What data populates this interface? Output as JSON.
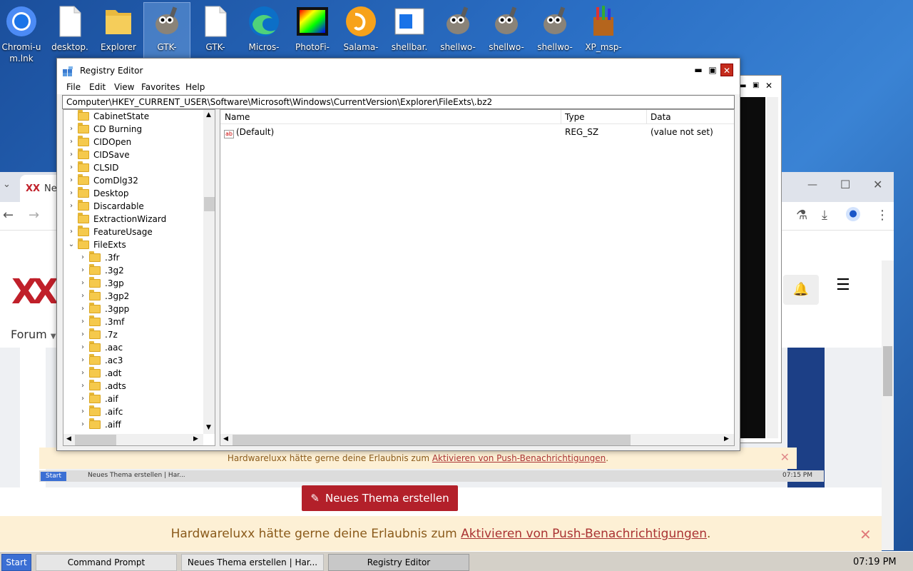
{
  "desktop": {
    "icons": [
      {
        "label": "Chromi-um.lnk",
        "icon": "chromium-icon"
      },
      {
        "label": "desktop.",
        "icon": "file-icon"
      },
      {
        "label": "Explorer",
        "icon": "folder-icon"
      },
      {
        "label": "GTK-",
        "icon": "gimp-icon"
      },
      {
        "label": "GTK-",
        "icon": "file-icon"
      },
      {
        "label": "Micros-",
        "icon": "edge-icon"
      },
      {
        "label": "PhotoFi-",
        "icon": "photofiltre-icon"
      },
      {
        "label": "Salama-",
        "icon": "salamander-icon"
      },
      {
        "label": "shellbar.",
        "icon": "window-icon"
      },
      {
        "label": "shellwo-",
        "icon": "gimp-icon"
      },
      {
        "label": "shellwo-",
        "icon": "gimp-icon"
      },
      {
        "label": "shellwo-",
        "icon": "gimp-icon"
      },
      {
        "label": "XP_msp-",
        "icon": "paint-icon"
      }
    ]
  },
  "browser": {
    "tab_label": "Ne",
    "site_nav": "Forum",
    "new_thread_button": "Neues Thema erstellen",
    "notification_text": "Hardwareluxx hätte gerne deine Erlaubnis zum ",
    "notification_link": "Aktivieren von Push-Benachrichtigungen",
    "notification_end": ".",
    "inner_taskbar_start": "Start",
    "inner_taskbar_item": "Neues Thema erstellen | Har...",
    "inner_clock": "07:15 PM"
  },
  "registry": {
    "title": "Registry Editor",
    "menu": [
      "File",
      "Edit",
      "View",
      "Favorites",
      "Help"
    ],
    "address": "Computer\\HKEY_CURRENT_USER\\Software\\Microsoft\\Windows\\CurrentVersion\\Explorer\\FileExts\\.bz2",
    "tree": [
      {
        "label": "CabinetState",
        "level": 0,
        "arrow": ""
      },
      {
        "label": "CD Burning",
        "level": 0,
        "arrow": "›"
      },
      {
        "label": "CIDOpen",
        "level": 0,
        "arrow": "›"
      },
      {
        "label": "CIDSave",
        "level": 0,
        "arrow": "›"
      },
      {
        "label": "CLSID",
        "level": 0,
        "arrow": "›"
      },
      {
        "label": "ComDlg32",
        "level": 0,
        "arrow": "›"
      },
      {
        "label": "Desktop",
        "level": 0,
        "arrow": "›"
      },
      {
        "label": "Discardable",
        "level": 0,
        "arrow": "›"
      },
      {
        "label": "ExtractionWizard",
        "level": 0,
        "arrow": ""
      },
      {
        "label": "FeatureUsage",
        "level": 0,
        "arrow": "›"
      },
      {
        "label": "FileExts",
        "level": 0,
        "arrow": "⌄"
      },
      {
        "label": ".3fr",
        "level": 1,
        "arrow": "›"
      },
      {
        "label": ".3g2",
        "level": 1,
        "arrow": "›"
      },
      {
        "label": ".3gp",
        "level": 1,
        "arrow": "›"
      },
      {
        "label": ".3gp2",
        "level": 1,
        "arrow": "›"
      },
      {
        "label": ".3gpp",
        "level": 1,
        "arrow": "›"
      },
      {
        "label": ".3mf",
        "level": 1,
        "arrow": "›"
      },
      {
        "label": ".7z",
        "level": 1,
        "arrow": "›"
      },
      {
        "label": ".aac",
        "level": 1,
        "arrow": "›"
      },
      {
        "label": ".ac3",
        "level": 1,
        "arrow": "›"
      },
      {
        "label": ".adt",
        "level": 1,
        "arrow": "›"
      },
      {
        "label": ".adts",
        "level": 1,
        "arrow": "›"
      },
      {
        "label": ".aif",
        "level": 1,
        "arrow": "›"
      },
      {
        "label": ".aifc",
        "level": 1,
        "arrow": "›"
      },
      {
        "label": ".aiff",
        "level": 1,
        "arrow": "›"
      }
    ],
    "columns": [
      "Name",
      "Type",
      "Data"
    ],
    "values": [
      {
        "name": "(Default)",
        "type": "REG_SZ",
        "data": "(value not set)"
      }
    ]
  },
  "taskbar": {
    "start": "Start",
    "items": [
      "Command Prompt",
      "Neues Thema erstellen | Har...",
      "Registry Editor"
    ],
    "clock": "07:19 PM"
  },
  "colors": {
    "accent_red": "#b3202a",
    "notification_bg": "#fdf0d5",
    "close_red": "#c42b1c"
  }
}
